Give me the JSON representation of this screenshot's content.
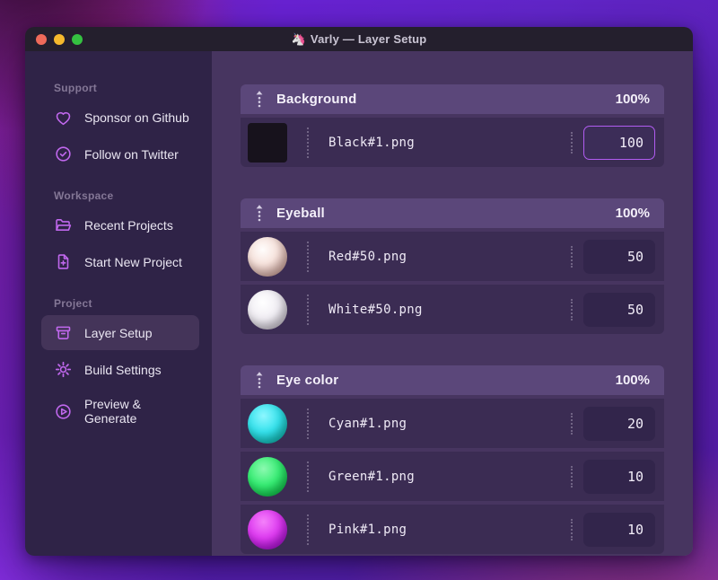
{
  "window": {
    "app_icon": "🦄",
    "title": "Varly — Layer Setup"
  },
  "titlebar_buttons": [
    "close",
    "minimize",
    "zoom"
  ],
  "sidebar": {
    "sections": [
      {
        "label": "Support",
        "items": [
          {
            "label": "Sponsor on Github",
            "icon": "heart-icon"
          },
          {
            "label": "Follow on Twitter",
            "icon": "verified-badge-icon"
          }
        ]
      },
      {
        "label": "Workspace",
        "items": [
          {
            "label": "Recent Projects",
            "icon": "folder-icon"
          },
          {
            "label": "Start New Project",
            "icon": "file-plus-icon"
          }
        ]
      },
      {
        "label": "Project",
        "items": [
          {
            "label": "Layer Setup",
            "icon": "layers-icon",
            "active": true
          },
          {
            "label": "Build Settings",
            "icon": "gear-icon"
          },
          {
            "label": "Preview & Generate",
            "icon": "play-circle-icon"
          }
        ]
      }
    ]
  },
  "layers": {
    "groups": [
      {
        "name": "Background",
        "weight": "100%",
        "items": [
          {
            "file": "Black#1.png",
            "value": "100",
            "thumb": "black-square",
            "focused": true
          }
        ]
      },
      {
        "name": "Eyeball",
        "weight": "100%",
        "items": [
          {
            "file": "Red#50.png",
            "value": "50",
            "thumb": "red-sphere"
          },
          {
            "file": "White#50.png",
            "value": "50",
            "thumb": "white-sphere"
          }
        ]
      },
      {
        "name": "Eye color",
        "weight": "100%",
        "items": [
          {
            "file": "Cyan#1.png",
            "value": "20",
            "thumb": "cyan-sphere"
          },
          {
            "file": "Green#1.png",
            "value": "10",
            "thumb": "green-sphere"
          },
          {
            "file": "Pink#1.png",
            "value": "10",
            "thumb": "pink-sphere"
          }
        ]
      }
    ]
  },
  "colors": {
    "accent": "#b15cf0",
    "icon_purple": "#c168ee",
    "traffic_red": "#ef6a5a",
    "traffic_yellow": "#f5b92d",
    "traffic_green": "#35c141",
    "thumb_black": "#17121c",
    "thumb_red": "#e9c7c0",
    "thumb_white": "#f2f0f4",
    "thumb_cyan": "#24d4d8",
    "thumb_green": "#2ae86a",
    "thumb_pink": "#d92df0"
  }
}
